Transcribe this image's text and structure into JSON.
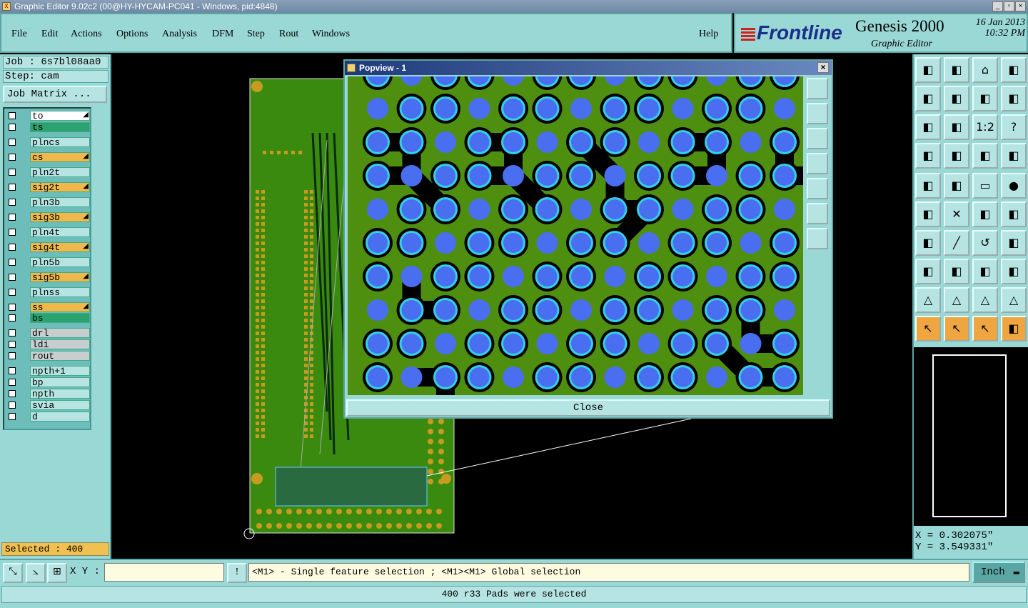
{
  "window": {
    "title": "Graphic Editor 9.02c2 (00@HY-HYCAM-PC041 - Windows, pid:4848)",
    "controls": [
      "_",
      "▫",
      "×"
    ]
  },
  "menu": [
    "File",
    "Edit",
    "Actions",
    "Options",
    "Analysis",
    "DFM",
    "Step",
    "Rout",
    "Windows"
  ],
  "help_label": "Help",
  "brand": {
    "logo": "Frontline",
    "product": "Genesis 2000",
    "subtitle": "Graphic Editor",
    "date": "16 Jan 2013",
    "time": "10:32 PM"
  },
  "job": {
    "job_line": "Job : 6s7bl08aa0",
    "step_line": "Step: cam",
    "matrix_label": "Job Matrix ..."
  },
  "layers": [
    {
      "name": "to",
      "color": "#ffffff",
      "arrow": true
    },
    {
      "name": "ts",
      "color": "#2aa36e",
      "arrow": false
    },
    {
      "name": "plncs",
      "color": "#b6e4e2",
      "arrow": false
    },
    {
      "name": "cs",
      "color": "#f0b84a",
      "arrow": true
    },
    {
      "name": "pln2t",
      "color": "#b6e4e2",
      "arrow": false
    },
    {
      "name": "sig2t",
      "color": "#f0b84a",
      "arrow": true
    },
    {
      "name": "pln3b",
      "color": "#b6e4e2",
      "arrow": false
    },
    {
      "name": "sig3b",
      "color": "#f0b84a",
      "arrow": true
    },
    {
      "name": "pln4t",
      "color": "#b6e4e2",
      "arrow": false
    },
    {
      "name": "sig4t",
      "color": "#f0b84a",
      "arrow": true
    },
    {
      "name": "pln5b",
      "color": "#b6e4e2",
      "arrow": false
    },
    {
      "name": "sig5b",
      "color": "#f0b84a",
      "arrow": true
    },
    {
      "name": "plnss",
      "color": "#b6e4e2",
      "arrow": false
    },
    {
      "name": "ss",
      "color": "#f0b84a",
      "arrow": true
    },
    {
      "name": "bs",
      "color": "#2aa36e",
      "arrow": false
    },
    {
      "name": "drl",
      "color": "#c8cdd0",
      "arrow": false
    },
    {
      "name": "ldi",
      "color": "#c8cdd0",
      "arrow": false
    },
    {
      "name": "rout",
      "color": "#c8cdd0",
      "arrow": false
    },
    {
      "name": "npth+1",
      "color": "#b6e4e2",
      "arrow": false
    },
    {
      "name": "bp",
      "color": "#b6e4e2",
      "arrow": false
    },
    {
      "name": "npth",
      "color": "#b6e4e2",
      "arrow": false
    },
    {
      "name": "svia",
      "color": "#b6e4e2",
      "arrow": false
    },
    {
      "name": "d",
      "color": "#b6e4e2",
      "arrow": false
    }
  ],
  "selected_count": "Selected : 400",
  "popview": {
    "title": "Popview - 1",
    "close_label": "Close"
  },
  "coords": {
    "x": "X = 0.302075\"",
    "y": "Y = 3.549331\""
  },
  "command": {
    "xy_label": "X Y :",
    "xy_value": "",
    "hint": "<M1> - Single feature selection ; <M1><M1> Global selection",
    "units": "Inch"
  },
  "status": "400 r33 Pads were selected"
}
